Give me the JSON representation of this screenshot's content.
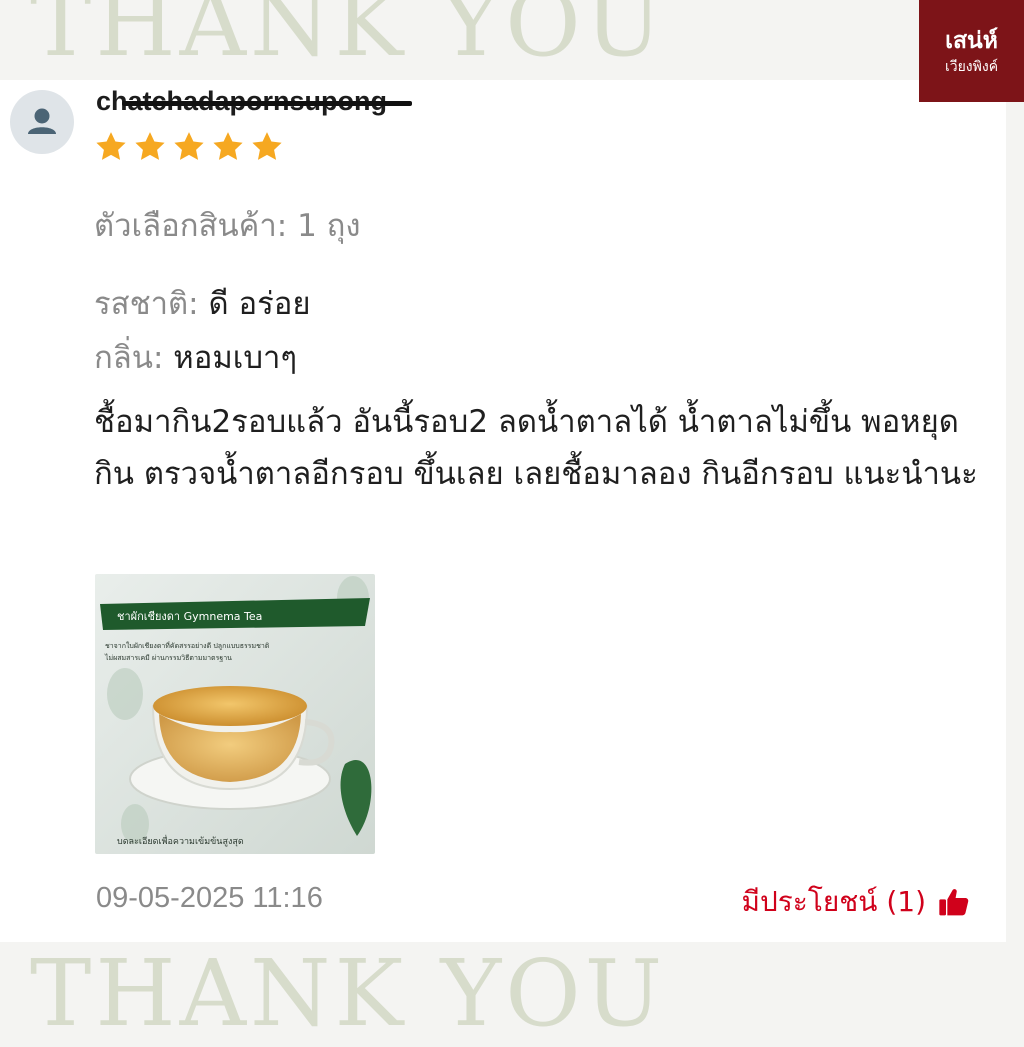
{
  "banner": {
    "top_text": "THANK YOU",
    "bottom_text": "THANK YOU"
  },
  "logo": {
    "line1": "เสน่ห์",
    "line2": "เวียงพิงค์"
  },
  "review": {
    "username": "chatchadapornsupong",
    "rating": 5,
    "variant": "ตัวเลือกสินค้า: 1 ถุง",
    "details": [
      {
        "label": "รสชาติ:",
        "value": "ดี อร่อย"
      },
      {
        "label": "กลิ่น:",
        "value": "หอมเบาๆ"
      }
    ],
    "comment": "ชื้อมากิน2รอบแล้ว อันนี้รอบ2 ลดน้ำตาลได้ น้ำตาลไม่ขึ้น พอหยุด กิน ตรวจน้ำตาลอีกรอบ ขึ้นเลย เลยชื้อมาลอง กินอีกรอบ แนะนำนะ",
    "image_text": {
      "title": "ชาผักเชียงดา Gymnema Tea",
      "line1": "ชาจากใบผักเชียงดาที่คัดสรรอย่างดี ปลูกแบบธรรมชาติ",
      "line2": "ไม่ผสมสารเคมี ผ่านกรรมวิธีตามมาตรฐาน",
      "bottom": "บดละเอียดเพื่อความเข้มข้นสูงสุด"
    },
    "date": "09-05-2025 11:16",
    "helpful_label": "มีประโยชน์ (1)"
  },
  "colors": {
    "star": "#f6a821",
    "helpful": "#d0011b",
    "logo_bg": "#7d1418"
  }
}
